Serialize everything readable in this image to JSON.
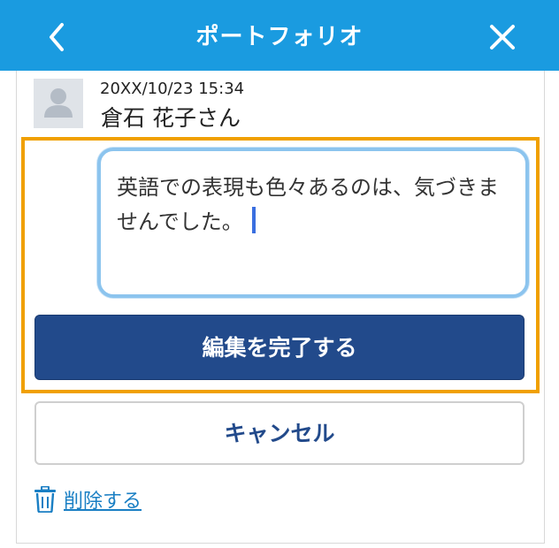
{
  "header": {
    "title": "ポートフォリオ",
    "back_icon": "chevron-left-icon",
    "close_icon": "close-icon",
    "background": "#1a9be0"
  },
  "post": {
    "avatar_icon": "user-avatar-icon",
    "timestamp": "20XX/10/23 15:34",
    "author": "倉石 花子さん"
  },
  "editor": {
    "text": "英語での表現も色々あるのは、気づきませんでした。",
    "focus_color": "#8cc4ee",
    "highlight_color": "#f0a000"
  },
  "actions": {
    "done_label": "編集を完了する",
    "cancel_label": "キャンセル",
    "delete_label": "削除する",
    "delete_icon": "trash-icon",
    "primary_color": "#224a8b",
    "link_color": "#1a7fc4"
  }
}
